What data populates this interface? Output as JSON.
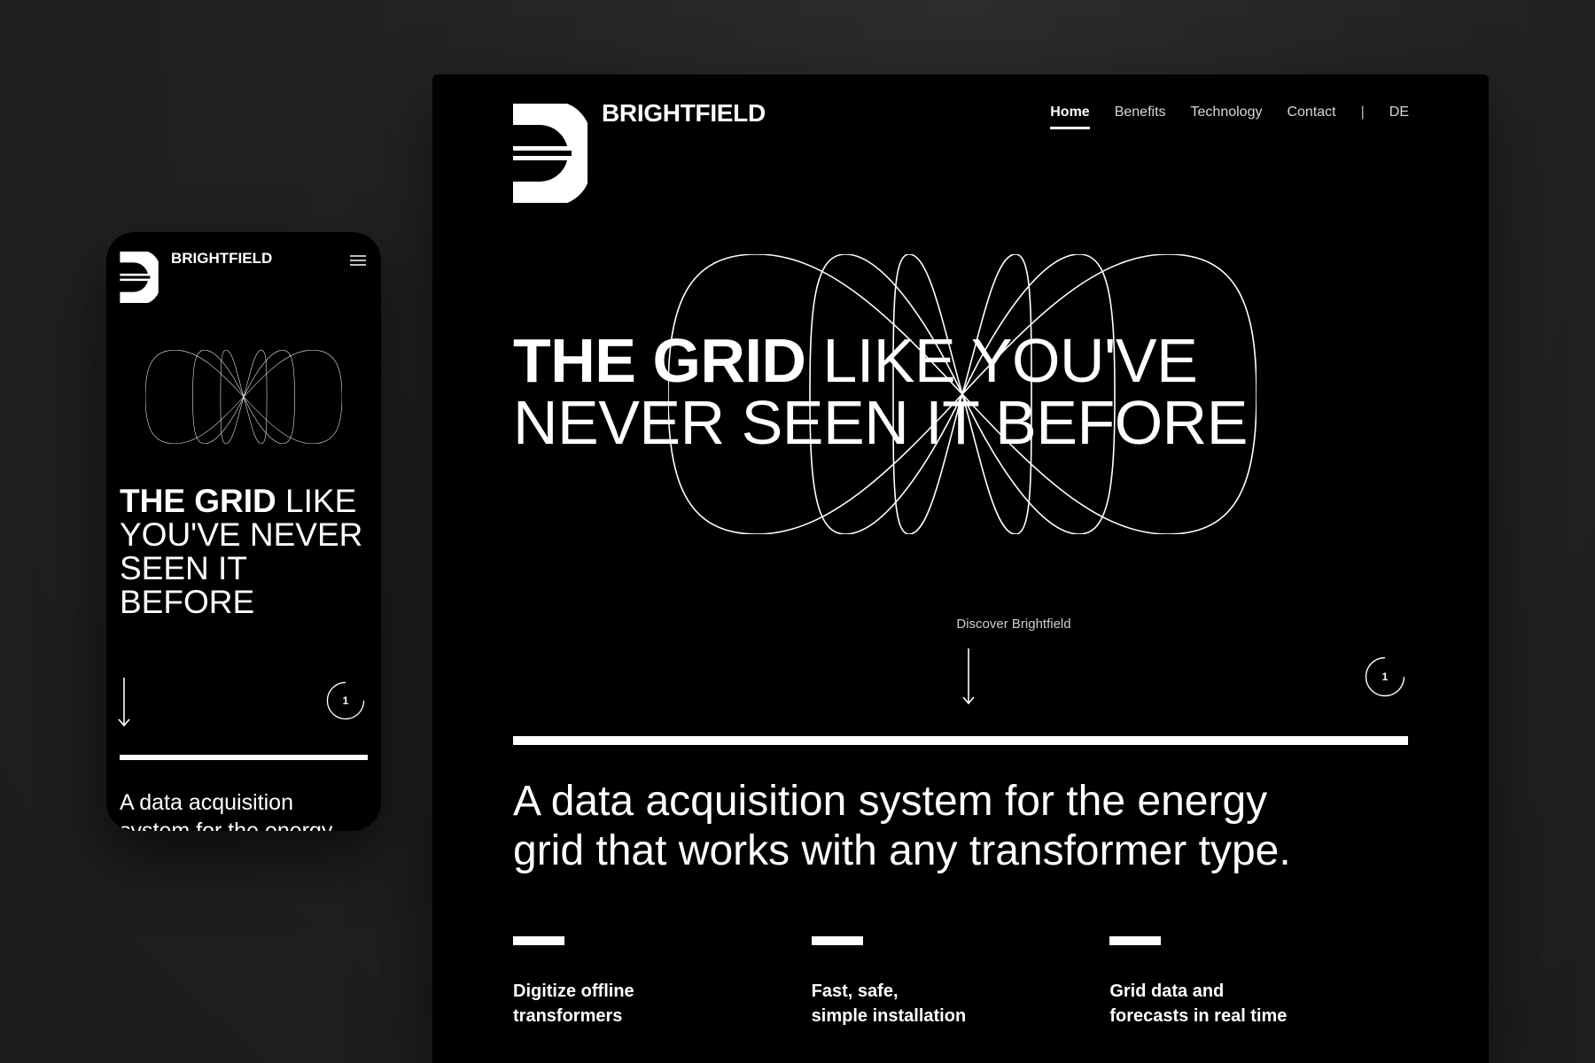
{
  "brand": {
    "name": "BRIGHTFIELD",
    "logo_icon": "brightfield-b-logo"
  },
  "desktop": {
    "nav": {
      "items": [
        {
          "label": "Home",
          "active": true
        },
        {
          "label": "Benefits"
        },
        {
          "label": "Technology"
        },
        {
          "label": "Contact"
        }
      ],
      "separator": "|",
      "language": "DE"
    },
    "hero": {
      "title_bold": "THE GRID",
      "title_line1_rest": " LIKE YOU'VE",
      "title_line2": "NEVER SEEN IT BEFORE"
    },
    "discover_label": "Discover Brightfield",
    "slide_counter": "1",
    "tagline_line1": "A data acquisition system for the energy",
    "tagline_line2": "grid that works with any transformer type.",
    "features": [
      {
        "text": "Digitize offline\ntransformers"
      },
      {
        "text": "Fast, safe,\nsimple installation"
      },
      {
        "text": "Grid data and\nforecasts in real time"
      }
    ]
  },
  "mobile": {
    "menu_icon": "hamburger-menu-icon",
    "hero": {
      "title_bold": "THE GRID",
      "title_rest": " LIKE YOU'VE NEVER SEEN IT BEFORE"
    },
    "slide_counter": "1",
    "tagline": "A data acquisition system for the energy"
  },
  "colors": {
    "page_bg": "#222222",
    "screen_bg": "#000000",
    "foreground": "#ffffff"
  }
}
